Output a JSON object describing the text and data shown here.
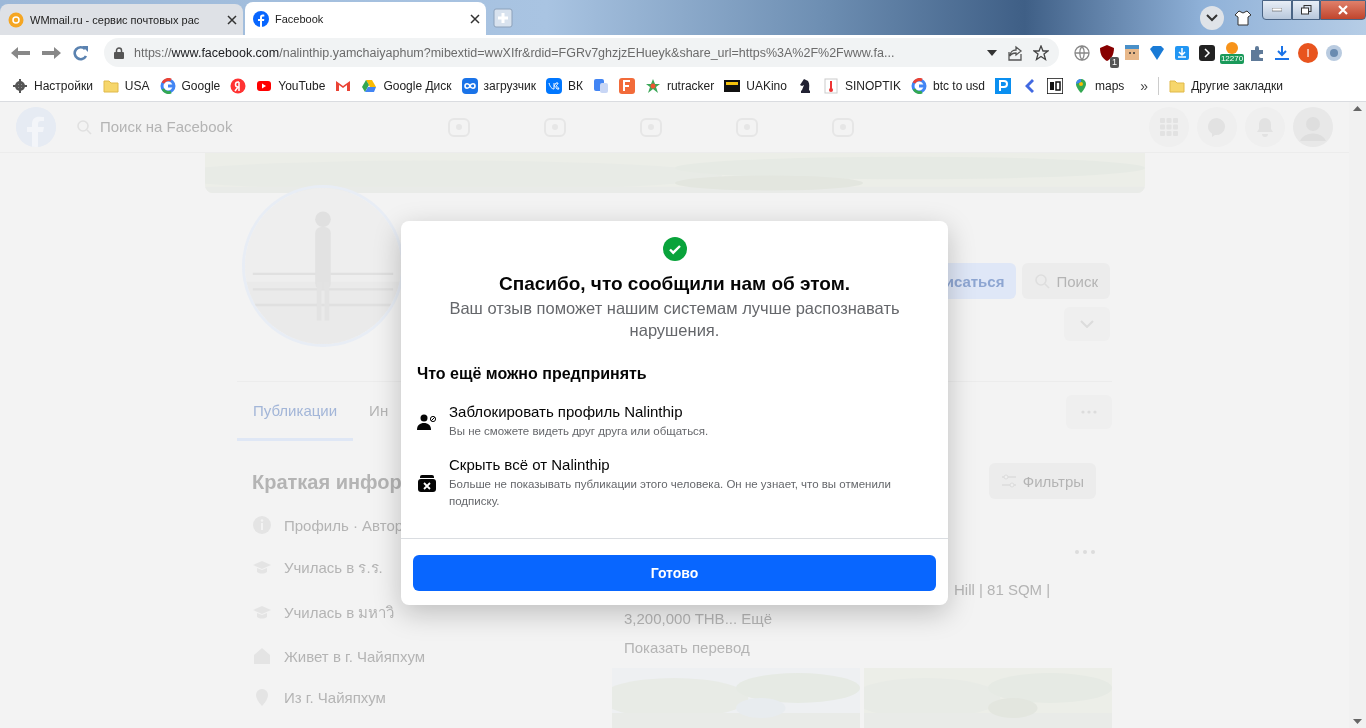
{
  "browser": {
    "tabs": [
      {
        "title": "WMmail.ru - сервис почтовых рас",
        "kind": "wmmail",
        "selected": false
      },
      {
        "title": "Facebook",
        "kind": "facebook",
        "selected": true
      }
    ],
    "address": {
      "scheme": "https://",
      "host": "www.facebook.com",
      "path": "/nalinthip.yamchaiyaphum?mibextid=wwXIfr&rdid=FGRv7ghzjzEHueyk&share_url=https%3A%2F%2Fwww.fa..."
    },
    "extensions": [
      {
        "kind": "globe"
      },
      {
        "kind": "shield",
        "badge": "1"
      },
      {
        "kind": "face"
      },
      {
        "kind": "diamond"
      },
      {
        "kind": "save"
      },
      {
        "kind": "terminal"
      },
      {
        "kind": "bitcoin",
        "badge": "12270"
      },
      {
        "kind": "puzzle"
      },
      {
        "kind": "download"
      },
      {
        "kind": "profile",
        "badge": "I"
      },
      {
        "kind": "wheel"
      }
    ],
    "bookmarks": [
      {
        "label": "Настройки",
        "kind": "gear"
      },
      {
        "label": "USA",
        "kind": "folder"
      },
      {
        "label": "Google",
        "kind": "google"
      },
      {
        "kind": "yandex"
      },
      {
        "label": "YouTube",
        "kind": "youtube"
      },
      {
        "kind": "gmail"
      },
      {
        "label": "Google Диск",
        "kind": "drive"
      },
      {
        "label": "загрузчик",
        "kind": "infinity"
      },
      {
        "label": "ВК",
        "kind": "vk"
      },
      {
        "kind": "translate"
      },
      {
        "kind": "fsquare"
      },
      {
        "label": "rutracker",
        "kind": "star"
      },
      {
        "label": "UAKino",
        "kind": "film"
      },
      {
        "kind": "knight"
      },
      {
        "label": "SINOPTIK",
        "kind": "thermo"
      },
      {
        "label": "btc to usd",
        "kind": "google"
      },
      {
        "kind": "psquare"
      },
      {
        "kind": "arrow"
      },
      {
        "kind": "bc"
      },
      {
        "label": "maps",
        "kind": "pin"
      }
    ],
    "more": "»",
    "other_bookmarks": "Другие закладки"
  },
  "page": {
    "search_placeholder": "Поиск на Facebook",
    "profile_buttons": [
      {
        "label": "исаться",
        "kind": "primary"
      },
      {
        "label": "Поиск",
        "kind": "search"
      }
    ],
    "tabs": [
      {
        "label": "Публикации",
        "selected": true
      },
      {
        "label": "Ин",
        "selected": false
      }
    ],
    "intro_title": "Краткая инфор",
    "intro_items": [
      {
        "text": "Профиль · Автор",
        "kind": "info"
      },
      {
        "text": "Училась в ร.ร.",
        "kind": "school"
      },
      {
        "text": "Училась в มหาวิ",
        "kind": "school"
      },
      {
        "text": "Живет в г. Чайяпхум",
        "kind": "home"
      },
      {
        "text": "Из г. Чайяпхум",
        "kind": "pin"
      }
    ],
    "filters": "Фильтры",
    "post": {
      "line_end": "Hill | 81 SQM |",
      "price": "3,200,000 THB... Ещё",
      "translate": "Показать перевод"
    }
  },
  "dialog": {
    "title": "Спасибо, что сообщили нам об этом.",
    "subtitle": "Ваш отзыв поможет нашим системам лучше распознавать нарушения.",
    "section": "Что ещё можно предпринять",
    "options": [
      {
        "title": "Заблокировать профиль Nalinthip",
        "description": "Вы не сможете видеть друг друга или общаться.",
        "kind": "block"
      },
      {
        "title": "Скрыть всё от Nalinthip",
        "description": "Больше не показывать публикации этого человека. Он не узнает, что вы отменили подписку.",
        "kind": "hide"
      }
    ],
    "button": "Готово"
  }
}
